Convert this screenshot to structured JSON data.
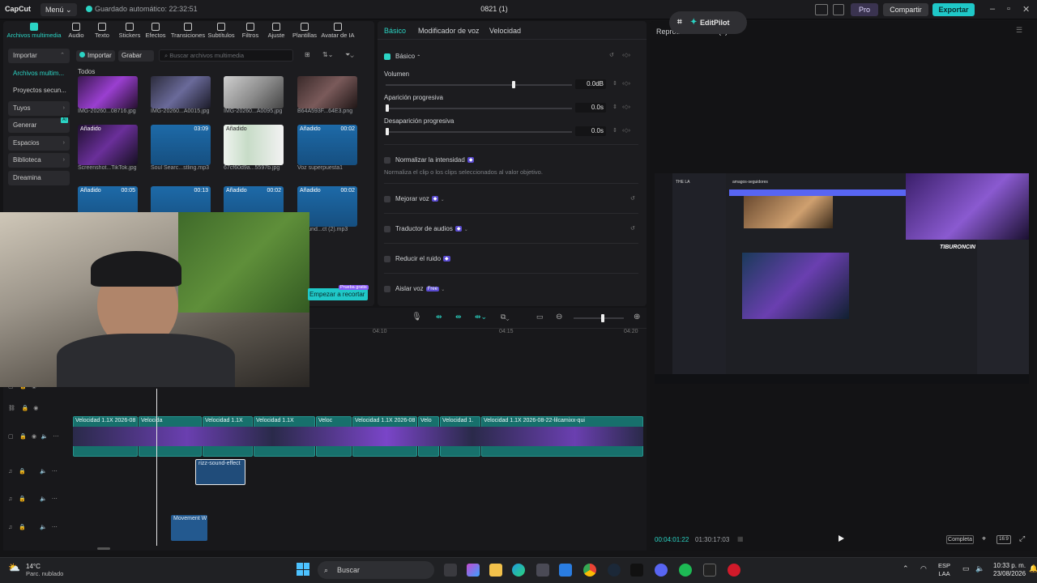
{
  "topbar": {
    "app_name": "CapCut",
    "menu_label": "Menú ⌄",
    "autosave": "Guardado automático: 22:32:51",
    "project_title": "0821 (1)",
    "pro_label": "Pro",
    "share_label": "Compartir",
    "export_label": "Exportar",
    "colors": {
      "accent": "#1fc8c8"
    }
  },
  "media": {
    "tools": [
      {
        "label": "Archivos multimedia",
        "icon": "media-icon"
      },
      {
        "label": "Audio",
        "icon": "audio-icon"
      },
      {
        "label": "Texto",
        "icon": "text-icon"
      },
      {
        "label": "Stickers",
        "icon": "sticker-icon"
      },
      {
        "label": "Efectos",
        "icon": "effects-icon"
      },
      {
        "label": "Transiciones",
        "icon": "transitions-icon"
      },
      {
        "label": "Subtítulos",
        "icon": "subtitles-icon"
      },
      {
        "label": "Filtros",
        "icon": "filters-icon"
      },
      {
        "label": "Ajuste",
        "icon": "adjust-icon"
      },
      {
        "label": "Plantillas",
        "icon": "templates-icon"
      },
      {
        "label": "Avatar de IA",
        "icon": "avatar-icon"
      }
    ],
    "sidebar": [
      {
        "label": "Importar",
        "chev": "⌃"
      },
      {
        "label": "Archivos multim..."
      },
      {
        "label": "Proyectos secun..."
      },
      {
        "label": "Tuyos",
        "chev": "›"
      },
      {
        "label": "Generar",
        "chev": "›",
        "badge": "AI"
      },
      {
        "label": "Espacios",
        "chev": "›"
      },
      {
        "label": "Biblioteca",
        "chev": "›"
      },
      {
        "label": "Dreamina"
      }
    ],
    "import_label": "Importar",
    "record_label": "Grabar",
    "search_placeholder": "Buscar archivos multimedia",
    "section_label": "Todos",
    "items": [
      {
        "name": "IMG-20260...08716.jpg",
        "badge": "",
        "duration": ""
      },
      {
        "name": "IMG-20260...A0015.jpg",
        "badge": "",
        "duration": ""
      },
      {
        "name": "IMG-20260...A0095.jpg",
        "badge": "",
        "duration": ""
      },
      {
        "name": "B64A593F...64E3.png",
        "badge": "",
        "duration": ""
      },
      {
        "name": "Screenshot...TikTok.jpg",
        "badge": "Añadido",
        "duration": ""
      },
      {
        "name": "Soul Searc...stling.mp3",
        "badge": "",
        "duration": "03:09"
      },
      {
        "name": "67cf60d9a...5597b.jpg",
        "badge": "Añadido",
        "duration": ""
      },
      {
        "name": "Voz superpuesta1",
        "badge": "Añadido",
        "duration": "00:02"
      },
      {
        "name": "",
        "badge": "Añadido",
        "duration": "00:05"
      },
      {
        "name": "",
        "badge": "",
        "duration": "00:13"
      },
      {
        "name": "",
        "badge": "Añadido",
        "duration": "00:02"
      },
      {
        "name": "...sound...ct (2).mp3",
        "badge": "Añadido",
        "duration": "00:02"
      }
    ],
    "crop_button": "Empezar a recortar",
    "crop_tag": "Prueba gratis"
  },
  "properties": {
    "tabs": [
      "Básico",
      "Modificador de voz",
      "Velocidad"
    ],
    "section": "Básico",
    "volume_label": "Volumen",
    "volume_value": "0.0dB",
    "volume_level": 0.68,
    "fade_in_label": "Aparición progresiva",
    "fade_in_value": "0.0s",
    "fade_out_label": "Desaparición progresiva",
    "fade_out_value": "0.0s",
    "normalize_label": "Normalizar la intensidad",
    "normalize_desc": "Normaliza el clip o los clips seleccionados al valor objetivo.",
    "enhance_label": "Mejorar voz",
    "translator_label": "Traductor de audios",
    "noise_label": "Reducir el ruido",
    "isolate_label": "Aislar voz",
    "isolate_badge": "Free"
  },
  "player": {
    "title": "Reproductor: 0821 (1)",
    "editpilot": "EditPilot",
    "current_time": "00:04:01:22",
    "total_time": "01:30:17:03",
    "fit_label": "Completa",
    "ratio_label": "16:9"
  },
  "screen_share": {
    "server_name": "THE LA",
    "channel": "amagos-seguidores",
    "watermark": "TIBURONCIN"
  },
  "timeline": {
    "ruler": [
      "04:10",
      "04:15",
      "04:20"
    ],
    "zoom_level": 0.55,
    "video_clips": [
      {
        "label": "Velocidad 1.1X   2026-08"
      },
      {
        "label": "Velocida"
      },
      {
        "label": "Velocidad 1.1X"
      },
      {
        "label": "Velocidad 1.1X"
      },
      {
        "label": "Veloc"
      },
      {
        "label": "Velocidad 1.1X   2026-08"
      },
      {
        "label": "Velo"
      },
      {
        "label": "Velocidad 1."
      },
      {
        "label": "Velocidad 1.1X   2026-08-22-lilcamixx-qui"
      }
    ],
    "sfx_clip": "rizz-sound-effect",
    "movement_clip": "Movement W"
  },
  "taskbar": {
    "temperature": "14°C",
    "weather": "Parc. nublado",
    "search": "Buscar",
    "lang": "ESP",
    "lang2": "LAA",
    "time": "10:33 p. m.",
    "date": "23/08/2026"
  }
}
